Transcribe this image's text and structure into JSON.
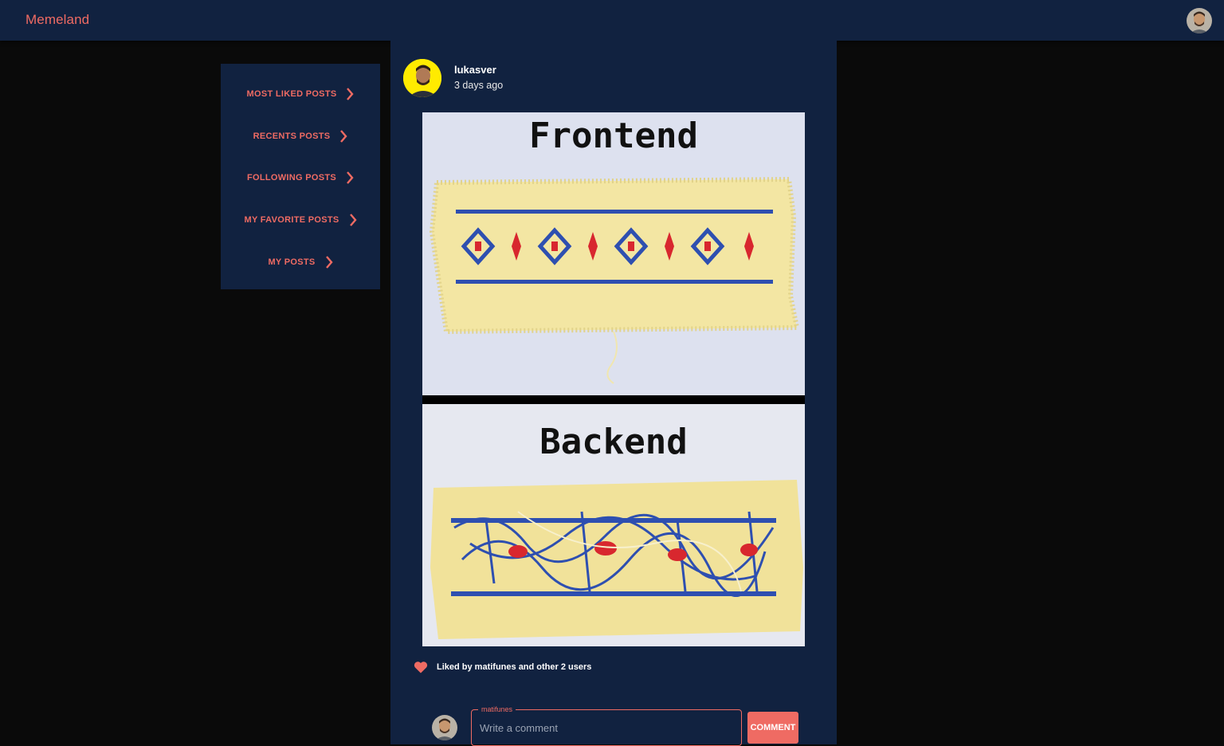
{
  "app": {
    "brand": "Memeland"
  },
  "sidebar": {
    "items": [
      {
        "label": "MOST LIKED POSTS"
      },
      {
        "label": "RECENTS POSTS"
      },
      {
        "label": "FOLLOWING POSTS"
      },
      {
        "label": "MY FAVORITE POSTS"
      },
      {
        "label": "MY POSTS"
      }
    ]
  },
  "post": {
    "username": "lukasver",
    "time_ago": "3 days ago",
    "image": {
      "top_caption": "Frontend",
      "bottom_caption": "Backend"
    },
    "likes_text": "Liked by matifunes and other 2 users"
  },
  "comment": {
    "user_label": "matifunes",
    "placeholder": "Write a comment",
    "button_label": "COMMENT"
  },
  "colors": {
    "accent": "#ef6b63",
    "navy": "#112240",
    "background": "#0a0a0a"
  },
  "icons": [
    "user-avatar-icon",
    "chevron-right-icon",
    "heart-icon"
  ]
}
